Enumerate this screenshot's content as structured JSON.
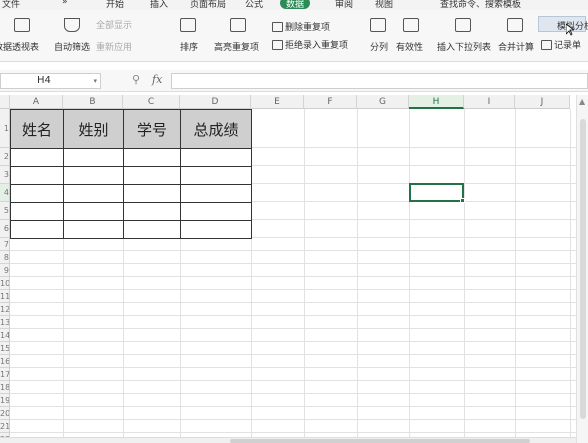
{
  "menu": {
    "file": "文件",
    "more": "»",
    "tabs": [
      "开始",
      "插入",
      "页面布局",
      "公式",
      "数据",
      "审阅",
      "视图"
    ],
    "active_tab": "数据",
    "search": "查找命令、搜索模板"
  },
  "ribbon": {
    "pivot": "数据透视表",
    "autofilter": "自动筛选",
    "show_all": "全部显示",
    "reapply": "重新应用",
    "sort": "排序",
    "highlight_dup": "高亮重复项",
    "delete_dup": "删除重复项",
    "reject_dup": "拒绝录入重复项",
    "split": "分列",
    "validity": "有效性",
    "dropdown": "插入下拉列表",
    "consolidate": "合并计算",
    "simulate": "模拟分析",
    "record": "记录单"
  },
  "formula_bar": {
    "cell_ref": "H4",
    "fx": "fx",
    "value": ""
  },
  "columns": [
    "A",
    "B",
    "C",
    "D",
    "E",
    "F",
    "G",
    "H",
    "I",
    "J"
  ],
  "selected_column": "H",
  "row_numbers": [
    "1",
    "2",
    "3",
    "4",
    "5",
    "6",
    "7",
    "8",
    "9",
    "10",
    "11",
    "12",
    "13",
    "14",
    "15",
    "16",
    "17",
    "18",
    "19",
    "20",
    "21",
    "22"
  ],
  "table": {
    "headers": [
      "姓名",
      "姓别",
      "学号",
      "总成绩"
    ],
    "empty_rows": 5
  },
  "colors": {
    "active_tab": "#2e8b57",
    "selection": "#217346",
    "header_fill": "#cfcfcf"
  }
}
